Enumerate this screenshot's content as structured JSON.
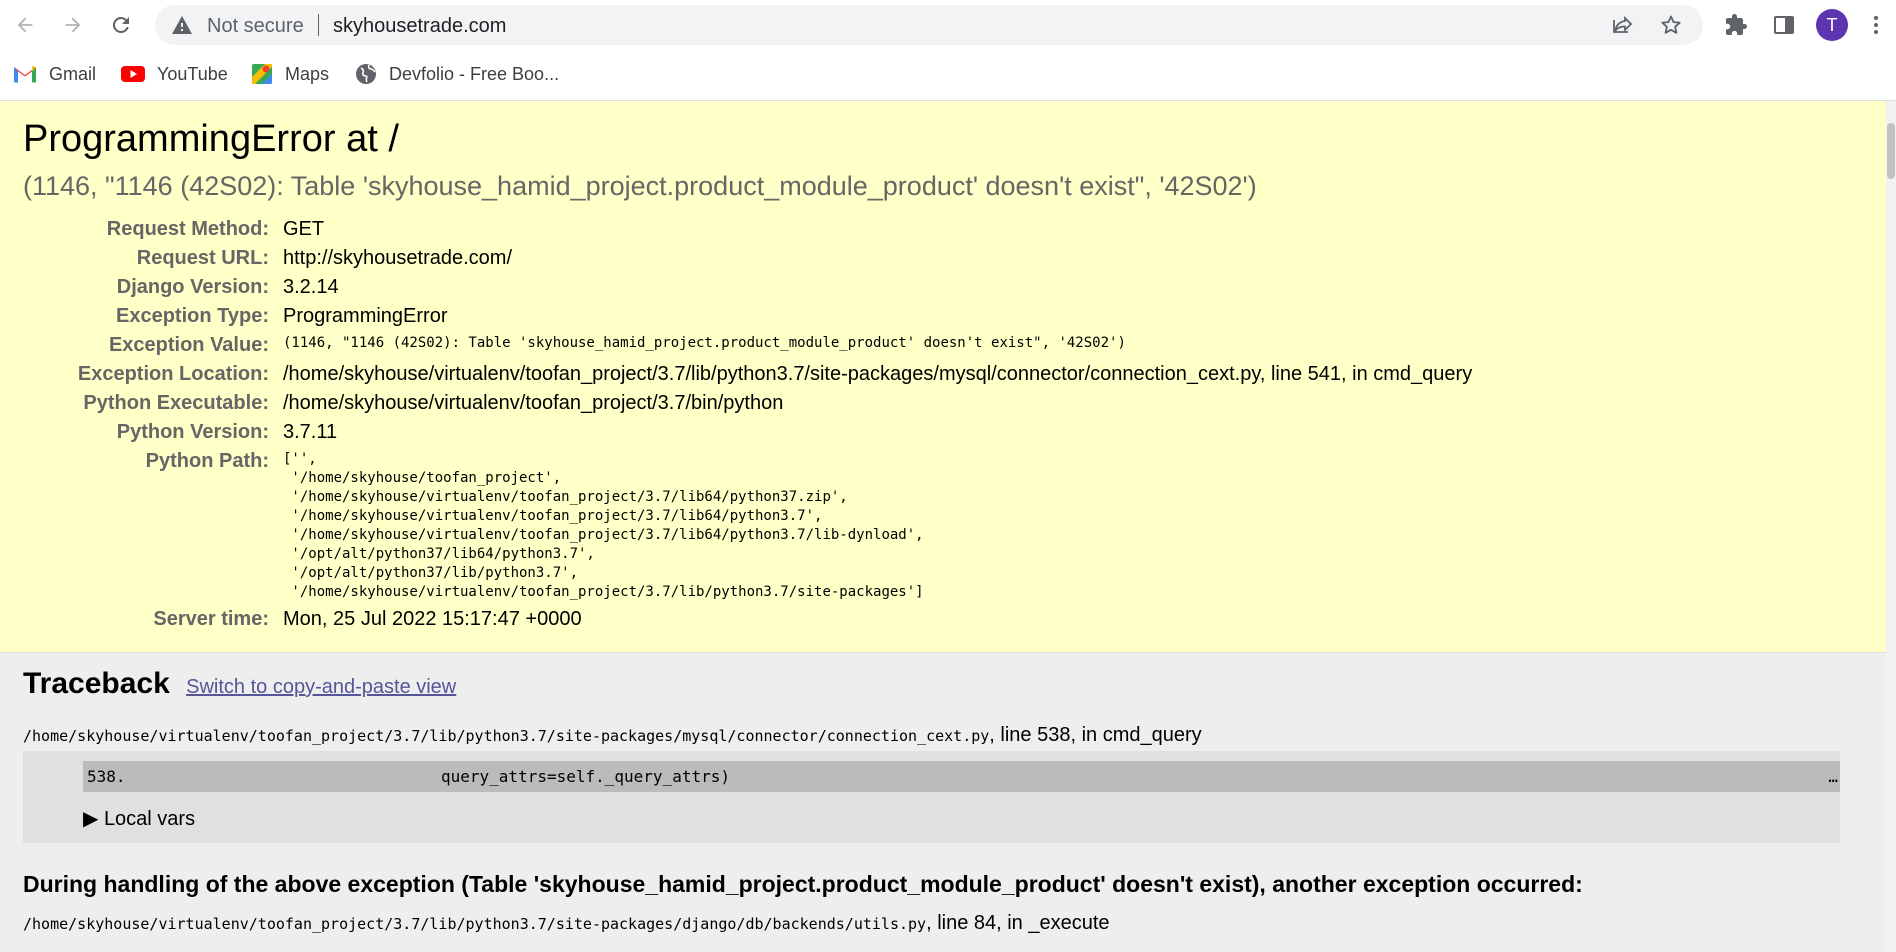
{
  "browser": {
    "security_label": "Not secure",
    "url": "skyhousetrade.com",
    "profile_initial": "T",
    "avatar_color": "#5e35b1",
    "bookmarks": [
      {
        "label": "Gmail",
        "icon": "gmail-icon"
      },
      {
        "label": "YouTube",
        "icon": "youtube-icon"
      },
      {
        "label": "Maps",
        "icon": "maps-icon"
      },
      {
        "label": "Devfolio - Free Boo...",
        "icon": "globe-icon"
      }
    ]
  },
  "error": {
    "title": "ProgrammingError at /",
    "message": "(1146, \"1146 (42S02): Table 'skyhouse_hamid_project.product_module_product' doesn't exist\", '42S02')",
    "meta": {
      "request_method_label": "Request Method:",
      "request_method": "GET",
      "request_url_label": "Request URL:",
      "request_url": "http://skyhousetrade.com/",
      "django_version_label": "Django Version:",
      "django_version": "3.2.14",
      "exception_type_label": "Exception Type:",
      "exception_type": "ProgrammingError",
      "exception_value_label": "Exception Value:",
      "exception_value": "(1146, \"1146 (42S02): Table 'skyhouse_hamid_project.product_module_product' doesn't exist\", '42S02')",
      "exception_location_label": "Exception Location:",
      "exception_location": "/home/skyhouse/virtualenv/toofan_project/3.7/lib/python3.7/site-packages/mysql/connector/connection_cext.py, line 541, in cmd_query",
      "python_executable_label": "Python Executable:",
      "python_executable": "/home/skyhouse/virtualenv/toofan_project/3.7/bin/python",
      "python_version_label": "Python Version:",
      "python_version": "3.7.11",
      "python_path_label": "Python Path:",
      "python_path": "['',\n '/home/skyhouse/toofan_project',\n '/home/skyhouse/virtualenv/toofan_project/3.7/lib64/python37.zip',\n '/home/skyhouse/virtualenv/toofan_project/3.7/lib64/python3.7',\n '/home/skyhouse/virtualenv/toofan_project/3.7/lib64/python3.7/lib-dynload',\n '/opt/alt/python37/lib64/python3.7',\n '/opt/alt/python37/lib/python3.7',\n '/home/skyhouse/virtualenv/toofan_project/3.7/lib/python3.7/site-packages']",
      "server_time_label": "Server time:",
      "server_time": "Mon, 25 Jul 2022 15:17:47 +0000"
    }
  },
  "traceback": {
    "heading": "Traceback",
    "switch_link": "Switch to copy-and-paste view",
    "frame1": {
      "file": "/home/skyhouse/virtualenv/toofan_project/3.7/lib/python3.7/site-packages/mysql/connector/connection_cext.py",
      "location": ", line 538, in cmd_query",
      "line_no": "538.",
      "code": "query_attrs=self._query_attrs)",
      "ellipsis": "…",
      "local_vars": "▶ Local vars"
    },
    "during": "During handling of the above exception (Table 'skyhouse_hamid_project.product_module_product' doesn't exist), another exception occurred:",
    "frame2": {
      "file": "/home/skyhouse/virtualenv/toofan_project/3.7/lib/python3.7/site-packages/django/db/backends/utils.py",
      "location": ", line 84, in _execute"
    }
  }
}
